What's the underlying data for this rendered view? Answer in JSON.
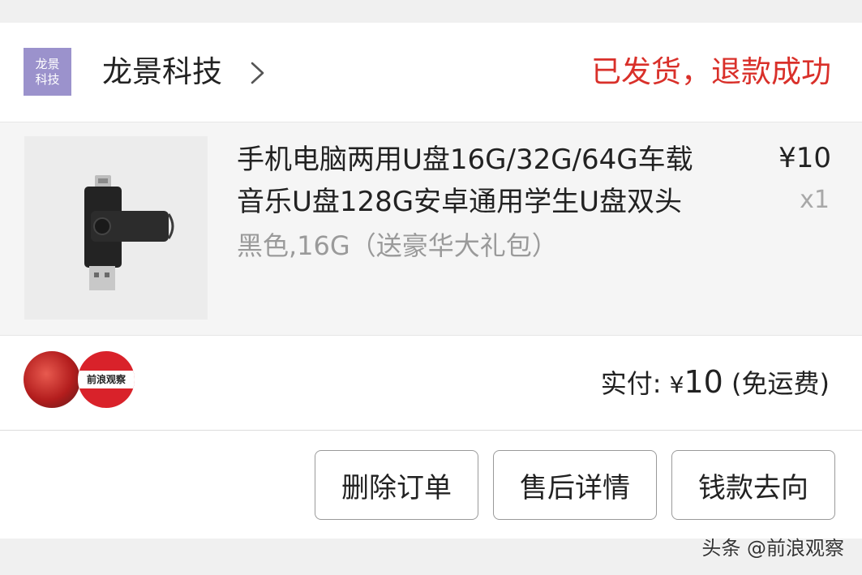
{
  "store": {
    "logo_line1": "龙景",
    "logo_line2": "科技",
    "name": "龙景科技",
    "order_status": "已发货，退款成功",
    "colors": {
      "logo_bg": "#9b92cc",
      "status": "#d9302a"
    }
  },
  "product": {
    "title_line1": "手机电脑两用U盘16G/32G/64G车载",
    "title_line2": "音乐U盘128G安卓通用学生U盘双头",
    "spec": "黑色,16G（送豪华大礼包）",
    "price": "¥10",
    "quantity": "x1"
  },
  "payment": {
    "label": "实付: ",
    "currency": "¥",
    "amount": "10",
    "note": " (免运费)"
  },
  "badges": {
    "badge2_text": "前浪观察"
  },
  "actions": {
    "delete_label": "删除订单",
    "aftersale_label": "售后详情",
    "money_label": "钱款去向"
  },
  "watermark": "头条 @前浪观察",
  "icons": {
    "store_chevron": "chevron-right-icon",
    "product_image": "usb-flash-drive-icon"
  }
}
